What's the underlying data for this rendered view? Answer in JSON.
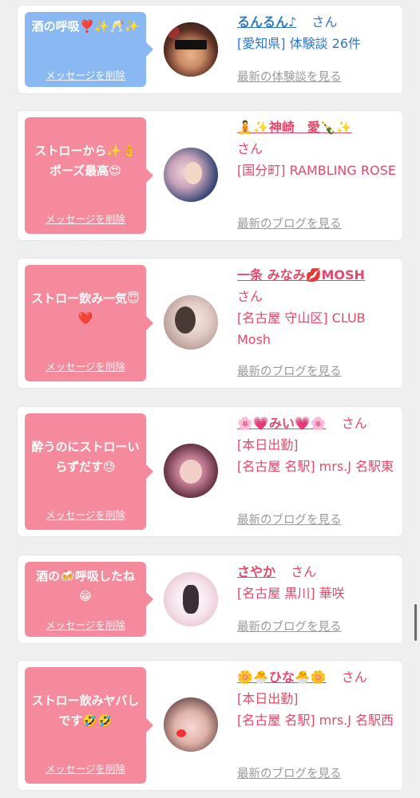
{
  "items": [
    {
      "message": "酒の呼吸❣️✨🥂✨",
      "delete_label": "メッセージを削除",
      "name": "るんるん♪",
      "san": "さん",
      "shop": "[愛知県] 体験談 26件",
      "link": "最新の体験談を見る",
      "color": "#2d77c9",
      "bubble_color": "#8ab8f2"
    },
    {
      "message": "ストローから✨👌ポーズ最高😍",
      "delete_label": "メッセージを削除",
      "name": "🧘✨神崎　愛🍾✨",
      "san": "さん",
      "shop": "[国分町] RAMBLING ROSE",
      "link": "最新のブログを見る",
      "color": "#e4486b",
      "bubble_color": "#f58a9d"
    },
    {
      "message": "ストロー飲み一気😇❤️",
      "delete_label": "メッセージを削除",
      "name": "一条 みなみ💋MOSH",
      "san": "さん",
      "shop": "[名古屋 守山区] CLUB Mosh",
      "link": "最新のブログを見る",
      "color": "#e4486b",
      "bubble_color": "#f58a9d"
    },
    {
      "message": "酔うのにストローいらずだす😓",
      "delete_label": "メッセージを削除",
      "name": "🌸💗みい💗🌸",
      "san": "さん",
      "status": "[本日出勤]",
      "shop": "[名古屋 名駅] mrs.J 名駅東",
      "link": "最新のブログを見る",
      "color": "#e4486b",
      "bubble_color": "#f58a9d"
    },
    {
      "message": "酒の🍻呼吸したね😁",
      "delete_label": "メッセージを削除",
      "name": "さやか",
      "san": "さん",
      "shop": "[名古屋 黒川] 華咲",
      "link": "最新のブログを見る",
      "color": "#e4486b",
      "bubble_color": "#f58a9d"
    },
    {
      "message": "ストロー飲みヤバしです🤣🤣",
      "delete_label": "メッセージを削除",
      "name": "🌼🐣ひな🐣🌼",
      "san": "さん",
      "status": "[本日出勤]",
      "shop": "[名古屋 名駅] mrs.J 名駅西",
      "link": "最新のブログを見る",
      "color": "#e4486b",
      "bubble_color": "#f58a9d"
    }
  ]
}
